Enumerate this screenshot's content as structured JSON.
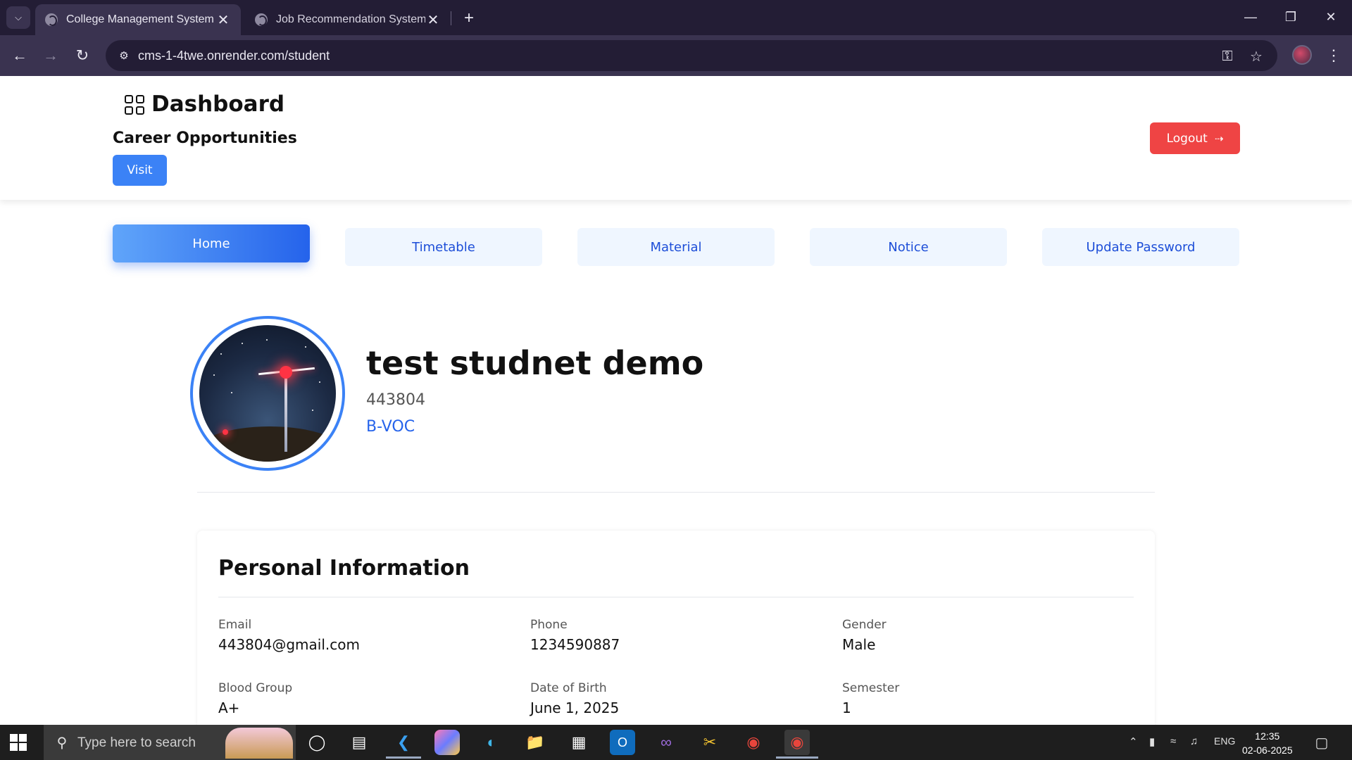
{
  "browser": {
    "tabs": [
      {
        "title": "College Management System",
        "active": true
      },
      {
        "title": "Job Recommendation System",
        "active": false
      }
    ],
    "url": "cms-1-4twe.onrender.com/student"
  },
  "header": {
    "dashboard_title": "Dashboard",
    "career_heading": "Career Opportunities",
    "visit_label": "Visit",
    "logout_label": "Logout"
  },
  "nav": {
    "tabs": [
      "Home",
      "Timetable",
      "Material",
      "Notice",
      "Update Password"
    ],
    "active": "Home"
  },
  "profile": {
    "name": "test studnet demo",
    "enrollment": "443804",
    "branch": "B-VOC"
  },
  "personal_info": {
    "title": "Personal Information",
    "fields": [
      {
        "label": "Email",
        "value": "443804@gmail.com"
      },
      {
        "label": "Phone",
        "value": "1234590887"
      },
      {
        "label": "Gender",
        "value": "Male"
      },
      {
        "label": "Blood Group",
        "value": "A+"
      },
      {
        "label": "Date of Birth",
        "value": "June 1, 2025"
      },
      {
        "label": "Semester",
        "value": "1"
      }
    ]
  },
  "taskbar": {
    "search_placeholder": "Type here to search",
    "language": "ENG",
    "time": "12:35",
    "date": "02-06-2025"
  },
  "colors": {
    "primary": "#3b82f6",
    "danger": "#ef4444",
    "nav_bg": "#eff6ff",
    "nav_text": "#1d4ed8",
    "browser_dark": "#231d35",
    "browser_toolbar": "#3a3350"
  }
}
